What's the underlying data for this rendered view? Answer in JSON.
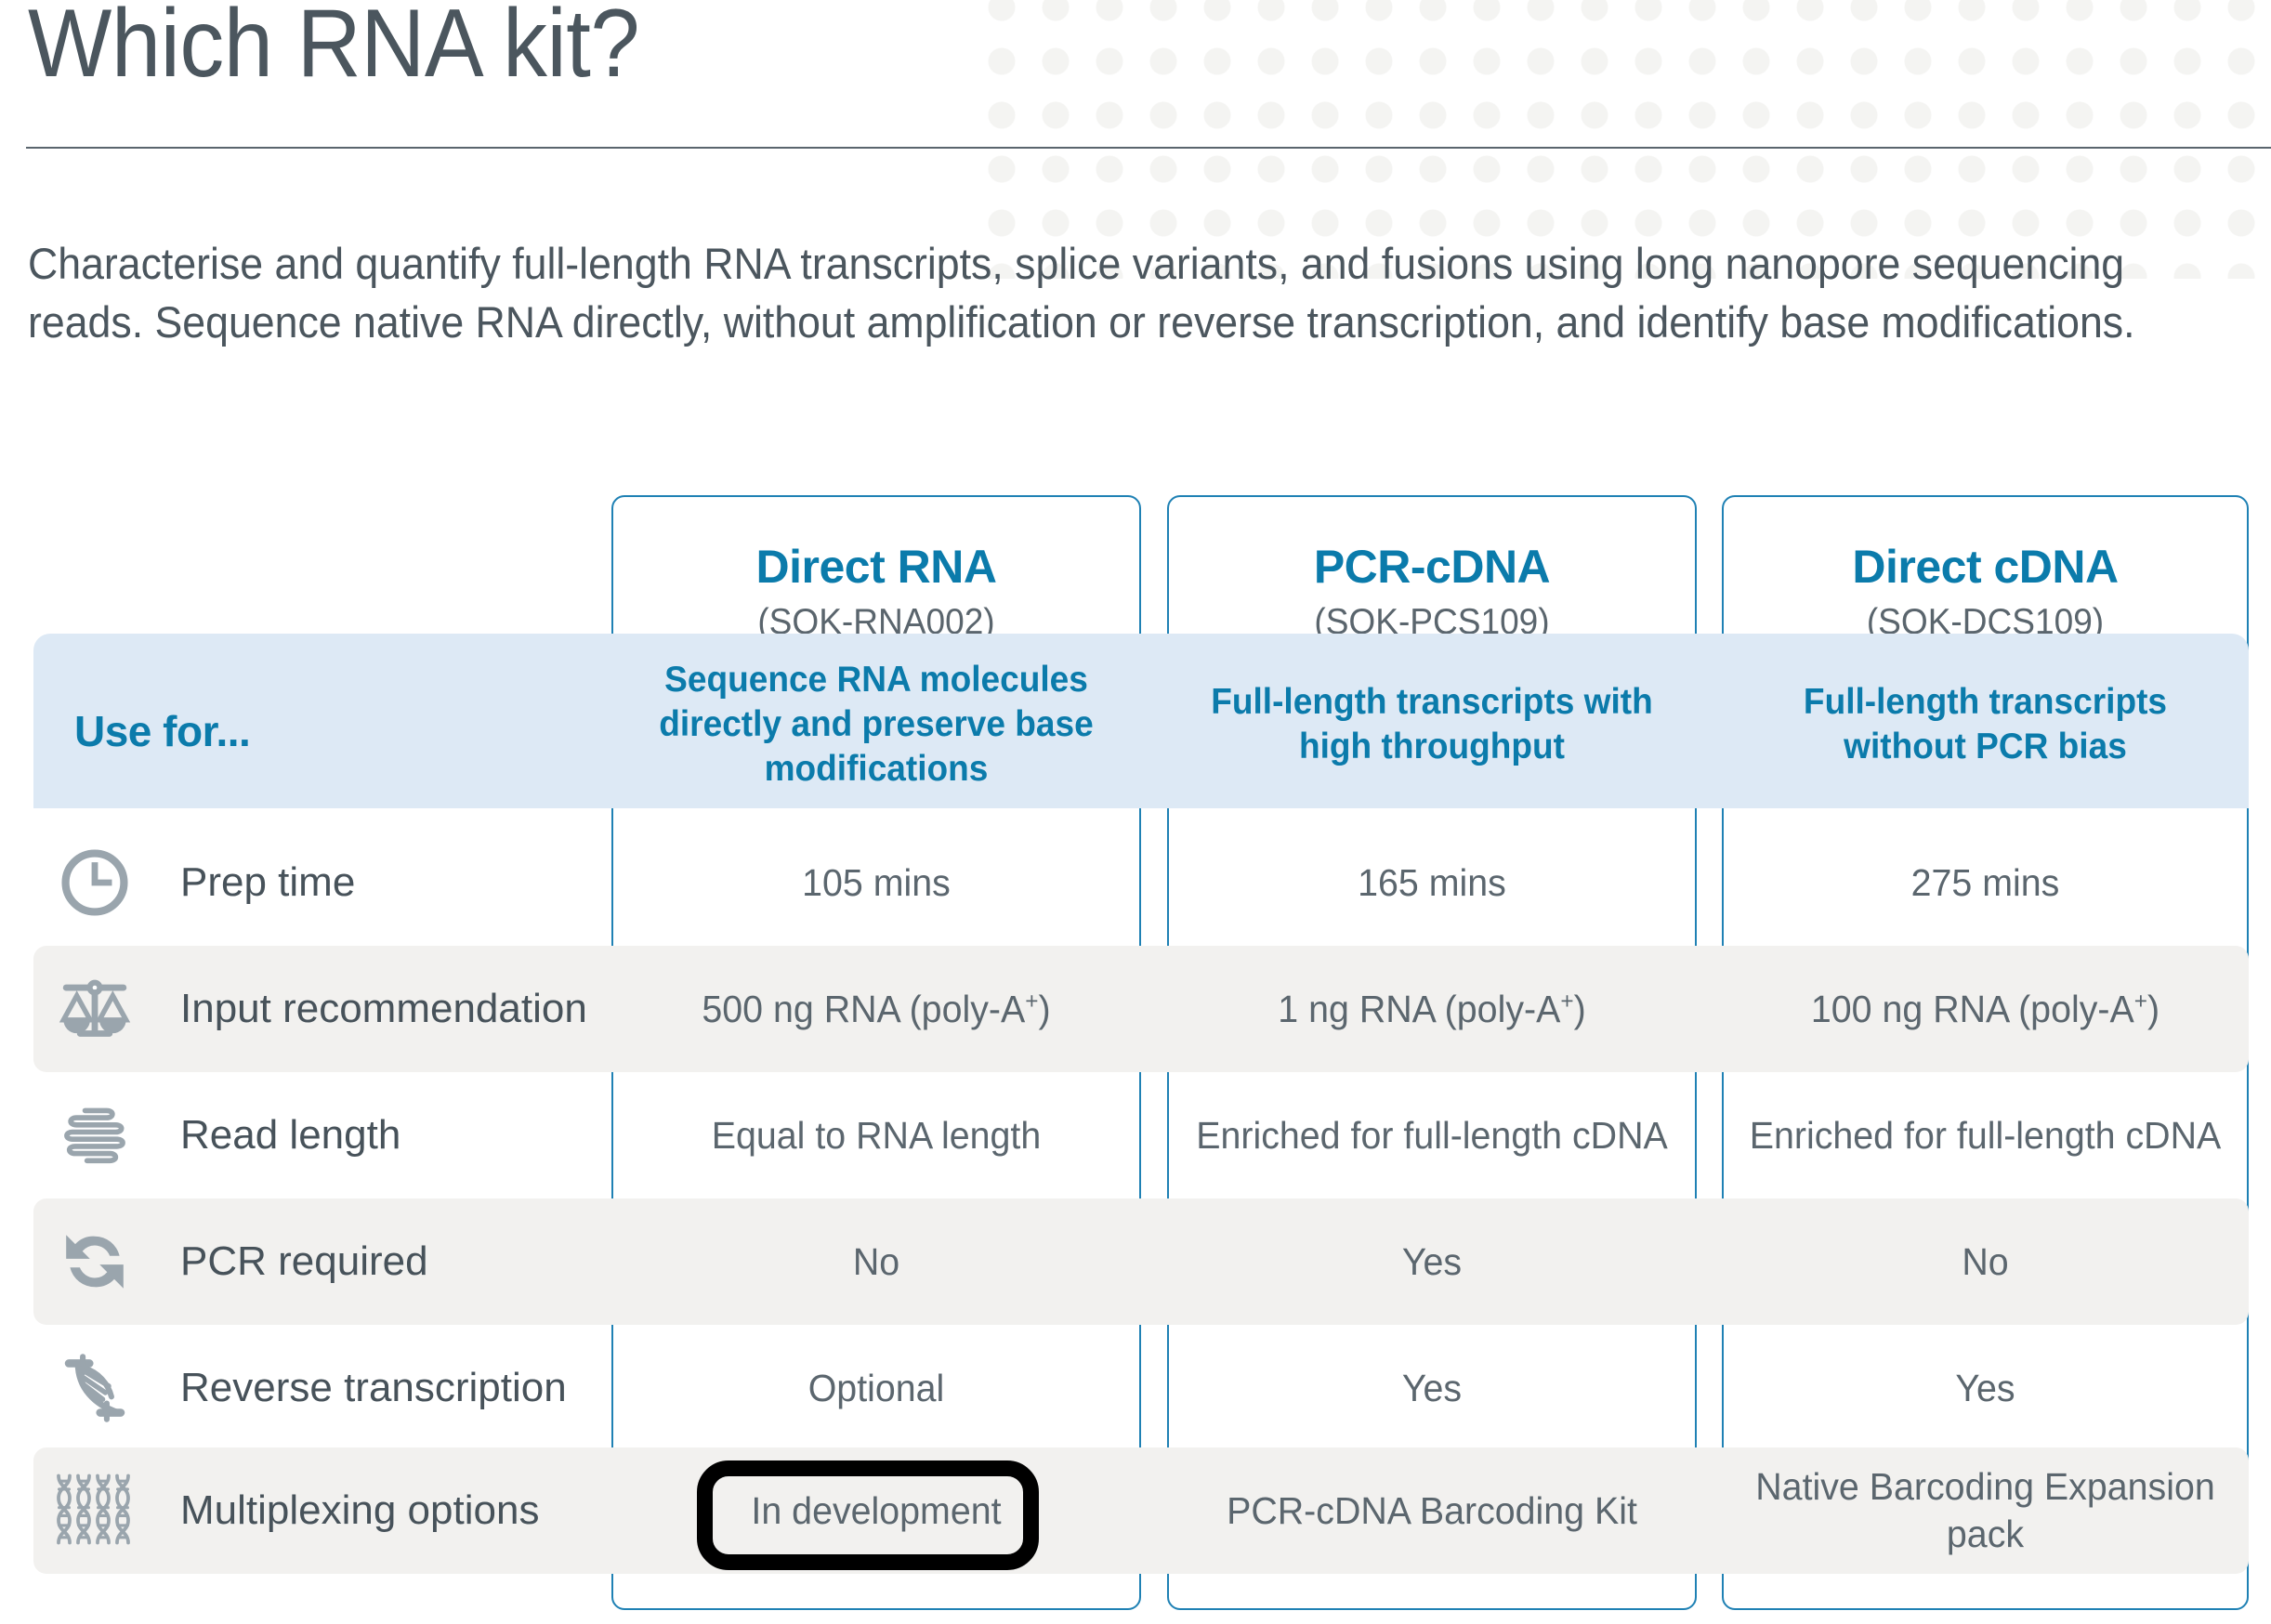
{
  "header": {
    "title": "Which RNA kit?",
    "intro": "Characterise and quantify full-length RNA transcripts, splice variants, and fusions using long nanopore sequencing reads. Sequence native RNA directly, without amplification or reverse transcription, and identify base modifications."
  },
  "colors": {
    "accent_blue": "#0b7bab",
    "card_border": "#1f81b4",
    "use_band": "#dde9f5",
    "row_shade": "#f2f1ef",
    "text_dark": "#4b565e",
    "icon_gray": "#9aa5ad",
    "annotation": "#000000"
  },
  "kits": [
    {
      "name": "Direct RNA",
      "code": "(SQK-RNA002)",
      "use_for": "Sequence RNA molecules directly and preserve base modifications"
    },
    {
      "name": "PCR-cDNA",
      "code": "(SQK-PCS109)",
      "use_for": "Full-length transcripts with high throughput"
    },
    {
      "name": "Direct cDNA",
      "code": "(SQK-DCS109)",
      "use_for": "Full-length transcripts without PCR bias"
    }
  ],
  "use_for_label": "Use for...",
  "rows": [
    {
      "icon": "clock-icon",
      "label": "Prep time",
      "values": [
        "105 mins",
        "165 mins",
        "275 mins"
      ]
    },
    {
      "icon": "balance-scale-icon",
      "label": "Input recommendation",
      "values": [
        "500 ng RNA (poly-A+)",
        "1 ng RNA (poly-A+)",
        "100 ng RNA (poly-A+)"
      ]
    },
    {
      "icon": "rna-strand-icon",
      "label": "Read length",
      "values": [
        "Equal to RNA length",
        "Enriched for full-length cDNA",
        "Enriched for full-length cDNA"
      ]
    },
    {
      "icon": "cycle-arrows-icon",
      "label": "PCR required",
      "values": [
        "No",
        "Yes",
        "No"
      ]
    },
    {
      "icon": "dna-helix-icon",
      "label": "Reverse transcription",
      "values": [
        "Optional",
        "Yes",
        "Yes"
      ]
    },
    {
      "icon": "dna-multiplex-icon",
      "label": "Multiplexing options",
      "values": [
        "In development",
        "PCR-cDNA Barcoding Kit",
        "Native Barcoding Expansion pack"
      ]
    }
  ],
  "annotation": {
    "target": "In development"
  }
}
